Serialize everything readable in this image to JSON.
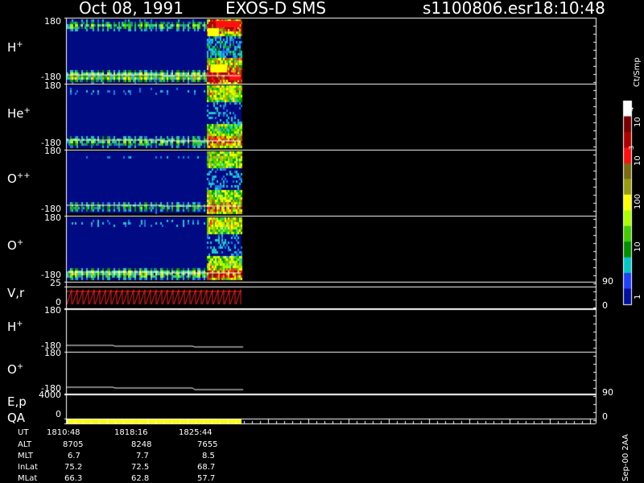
{
  "header": {
    "date": "Oct 08, 1991",
    "mission": "EXOS-D SMS",
    "file": "s1100806.esr",
    "time": "18:10:48"
  },
  "panels": [
    {
      "base": "H",
      "sup": "+",
      "top_tick": "180",
      "bot_tick": "-180"
    },
    {
      "base": "He",
      "sup": "+",
      "top_tick": "180",
      "bot_tick": "-180"
    },
    {
      "base": "O",
      "sup": "++",
      "top_tick": "180",
      "bot_tick": "-180"
    },
    {
      "base": "O",
      "sup": "+",
      "top_tick": "180",
      "bot_tick": "-180"
    },
    {
      "base": "V,r",
      "sup": "",
      "top_tick": "25",
      "bot_tick": "0",
      "right_top": "90",
      "right_bot": "0"
    },
    {
      "base": "H",
      "sup": "+",
      "top_tick": "180",
      "bot_tick": "-180"
    },
    {
      "base": "O",
      "sup": "+",
      "top_tick": "180",
      "bot_tick": "-180"
    },
    {
      "base": "E,p",
      "sup": "",
      "top_tick": "4000",
      "bot_tick": "0",
      "right_top": "90",
      "right_bot": "0"
    },
    {
      "base": "QA",
      "sup": ""
    }
  ],
  "colorbar": {
    "unit": "Ct/Smp",
    "labels": [
      "10",
      "4",
      "10",
      "3",
      "100",
      "10",
      "1"
    ],
    "colors": [
      "#ffffff",
      "#7a0000",
      "#b00000",
      "#ff1010",
      "#7a6a10",
      "#9a9a10",
      "#ffff00",
      "#aaff00",
      "#44cc00",
      "#009000",
      "#00c8c8",
      "#2040ff",
      "#0010a0"
    ]
  },
  "footer": {
    "rows": [
      {
        "label": "UT",
        "values": [
          "1810:48",
          "1818:16",
          "1825:44"
        ]
      },
      {
        "label": "ALT",
        "values": [
          "8705",
          "8248",
          "7655"
        ]
      },
      {
        "label": "MLT",
        "values": [
          "6.7",
          "7.7",
          "8.5"
        ]
      },
      {
        "label": "InLat",
        "values": [
          "75.2",
          "72.5",
          "68.7"
        ]
      },
      {
        "label": "MLat",
        "values": [
          "66.3",
          "62.8",
          "57.7"
        ]
      }
    ],
    "version": "Sep-00 2AA"
  },
  "chart_data": {
    "type": "heatmap",
    "title": "Oct 08, 1991   EXOS-D SMS",
    "x_ticks": [
      "1810:48",
      "1818:16",
      "1825:44"
    ],
    "spectrogram_panels": [
      "H+",
      "He+",
      "O+",
      "O++"
    ],
    "pitch_angle_range": [
      -180,
      180
    ],
    "color_scale": "log",
    "color_range": [
      1,
      10000
    ],
    "color_unit": "Ct/Smp",
    "vr_range": [
      0,
      25
    ],
    "ep_range": [
      0,
      4000
    ]
  }
}
